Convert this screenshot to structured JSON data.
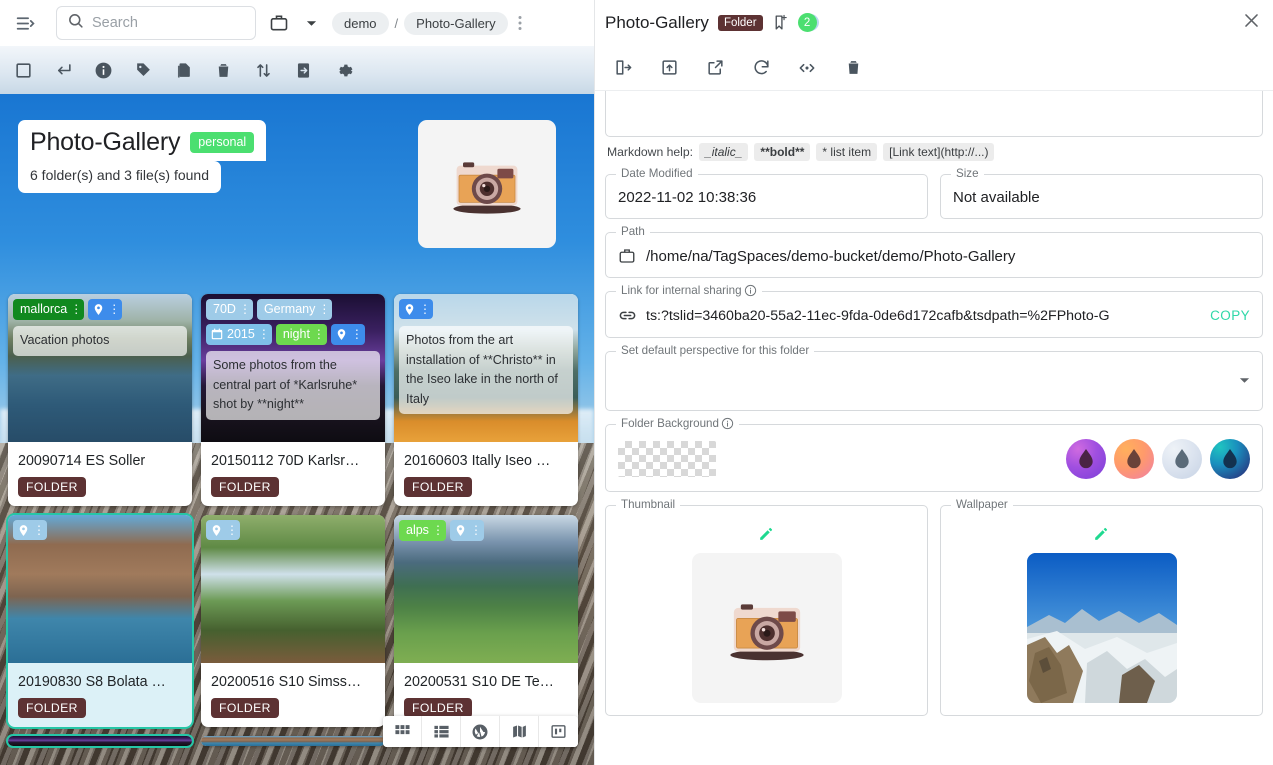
{
  "left": {
    "topbar": {
      "menu_icon": "hamburger-menu-icon",
      "search_placeholder": "Search",
      "location_icon": "briefcase-icon",
      "breadcrumb": [
        "demo",
        "Photo-Gallery"
      ],
      "breadcrumb_sep": "/"
    },
    "toolbar_icons": [
      "select-all-checkbox-icon",
      "navigate-back-icon",
      "info-icon",
      "tag-icon",
      "copy-icon",
      "delete-icon",
      "sort-icon",
      "move-to-icon",
      "settings-gear-icon"
    ],
    "hero": {
      "title": "Photo-Gallery",
      "tag": "personal",
      "summary": "6 folder(s) and 3 file(s) found",
      "thumb_icon": "camera-thumbnail"
    },
    "cards": [
      {
        "title": "20090714 ES Soller",
        "badge": "FOLDER",
        "photo": "ph-soller",
        "selected": false,
        "description": "Vacation photos",
        "desc_high": false,
        "tags": [
          {
            "label": "mallorca",
            "color": "#11891f",
            "type": "text"
          },
          {
            "label": "",
            "color": "#3d8ceb",
            "type": "geo"
          }
        ]
      },
      {
        "title": "20150112 70D Karlsr…",
        "badge": "FOLDER",
        "photo": "ph-karls",
        "selected": false,
        "description": "Some photos from the central part of *Karlsruhe* shot by **night**",
        "desc_high": true,
        "tags": [
          {
            "label": "70D",
            "color": "#9ecbe8",
            "type": "text"
          },
          {
            "label": "Germany",
            "color": "#9ecbe8",
            "type": "text"
          },
          {
            "label": "2015",
            "color": "#7fc0e8",
            "type": "date"
          },
          {
            "label": "night",
            "color": "#6dd94f",
            "type": "text"
          },
          {
            "label": "",
            "color": "#3d8ceb",
            "type": "geo"
          }
        ]
      },
      {
        "title": "20160603 Itally Iseo …",
        "badge": "FOLDER",
        "photo": "ph-iseo",
        "selected": false,
        "description": "Photos from the art installation of **Christo** in the Iseo lake in the north of Italy",
        "desc_high": false,
        "tags": [
          {
            "label": "",
            "color": "#3d8ceb",
            "type": "geo"
          }
        ]
      },
      {
        "title": "20190830 S8 Bolata …",
        "badge": "FOLDER",
        "photo": "ph-bolata",
        "selected": true,
        "description": "",
        "desc_high": false,
        "tags": [
          {
            "label": "",
            "color": "#9ecbe8",
            "type": "geo"
          }
        ]
      },
      {
        "title": "20200516 S10 Simss…",
        "badge": "FOLDER",
        "photo": "ph-simss",
        "selected": false,
        "description": "",
        "desc_high": false,
        "tags": [
          {
            "label": "",
            "color": "#9ecbe8",
            "type": "geo"
          }
        ]
      },
      {
        "title": "20200531 S10 DE Te…",
        "badge": "FOLDER",
        "photo": "ph-tegern",
        "selected": false,
        "description": "",
        "desc_high": false,
        "tags": [
          {
            "label": "alps",
            "color": "#6dd94f",
            "type": "text"
          },
          {
            "label": "",
            "color": "#9ecbe8",
            "type": "geo"
          }
        ]
      }
    ],
    "perspectives": [
      "grid-perspective-icon",
      "list-perspective-icon",
      "gallery-perspective-icon",
      "map-perspective-icon",
      "kanban-perspective-icon"
    ]
  },
  "right": {
    "header": {
      "title": "Photo-Gallery",
      "type_badge": "Folder",
      "bookmark_icon": "add-bookmark-icon",
      "badge_count": "2",
      "close_icon": "close-icon"
    },
    "toolbar_icons": [
      "open-in-main-area-icon",
      "open-parent-folder-icon",
      "open-natively-icon",
      "reload-icon",
      "resize-panel-icon",
      "delete-icon"
    ],
    "markdown_help": {
      "label": "Markdown help:",
      "chips": [
        "_italic_",
        "**bold**",
        "* list item",
        "[Link text](http://...)"
      ]
    },
    "date_modified": {
      "legend": "Date Modified",
      "value": "2022-11-02 10:38:36"
    },
    "size": {
      "legend": "Size",
      "value": "Not available"
    },
    "path": {
      "legend": "Path",
      "icon": "briefcase-icon",
      "value": "/home/na/TagSpaces/demo-bucket/demo/Photo-Gallery"
    },
    "sharing": {
      "legend": "Link for internal sharing",
      "info_icon": "info-circle-icon",
      "link_icon": "link-icon",
      "value": "ts:?tslid=3460ba20-55a2-11ec-9fda-0de6d172cafb&tsdpath=%2FPhoto-G",
      "copy_label": "COPY"
    },
    "perspective": {
      "legend": "Set default perspective for this folder",
      "value": ""
    },
    "background": {
      "legend": "Folder Background",
      "info_icon": "info-circle-icon",
      "swatches": [
        "purple-gradient",
        "orange-pink-gradient",
        "light-blue-gradient",
        "teal-navy-gradient"
      ]
    },
    "thumbnail": {
      "legend": "Thumbnail",
      "edit_icon": "edit-pencil-icon",
      "image": "camera-thumbnail"
    },
    "wallpaper": {
      "legend": "Wallpaper",
      "edit_icon": "edit-pencil-icon",
      "image": "mountain-photo"
    }
  },
  "colors": {
    "accent_green": "#4bdf70",
    "copy_teal": "#2fd8a8",
    "folder_badge": "#5d3233",
    "selection_border": "#26c6a6"
  }
}
